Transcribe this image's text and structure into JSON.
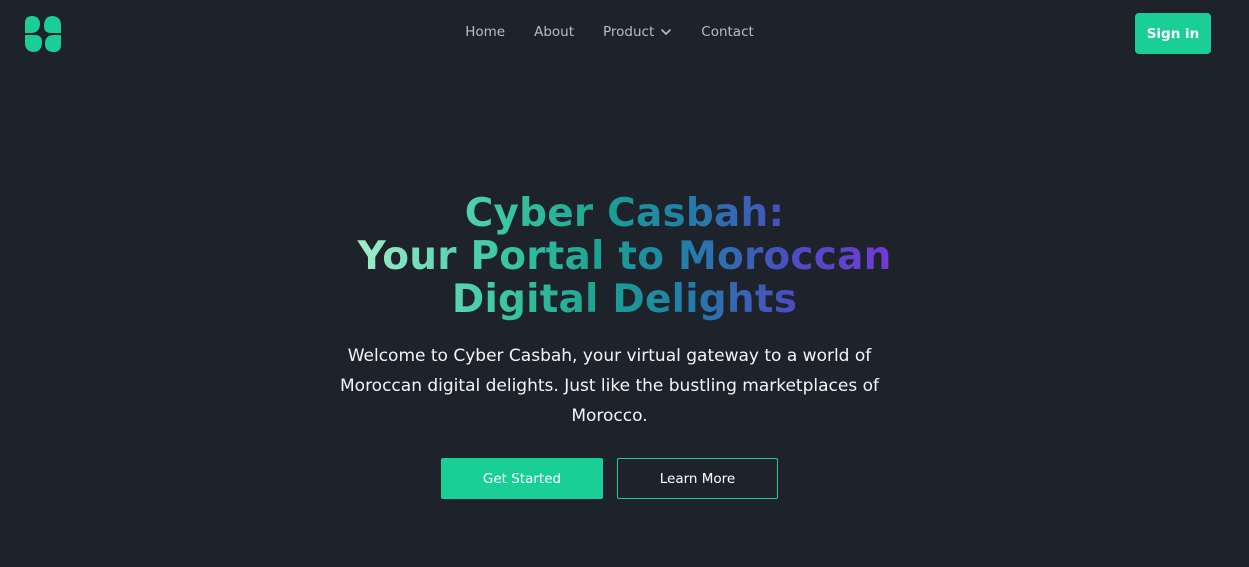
{
  "colors": {
    "background": "#1d222b",
    "accent": "#19cf96",
    "nav_text": "#b8bdc6",
    "body_text": "#f4f5f7"
  },
  "header": {
    "logo_icon": "clover-logo-icon",
    "nav": [
      {
        "label": "Home"
      },
      {
        "label": "About"
      },
      {
        "label": "Product",
        "icon": "chevron-down-icon"
      },
      {
        "label": "Contact"
      }
    ],
    "signin_label": "Sign in"
  },
  "hero": {
    "title_lines": [
      "Cyber Casbah:",
      "Your Portal to Moroccan",
      "Digital Delights"
    ],
    "description": "Welcome to Cyber Casbah, your virtual gateway to a world of Moroccan digital delights. Just like the bustling marketplaces of Morocco.",
    "primary_button": "Get Started",
    "secondary_button": "Learn More"
  }
}
